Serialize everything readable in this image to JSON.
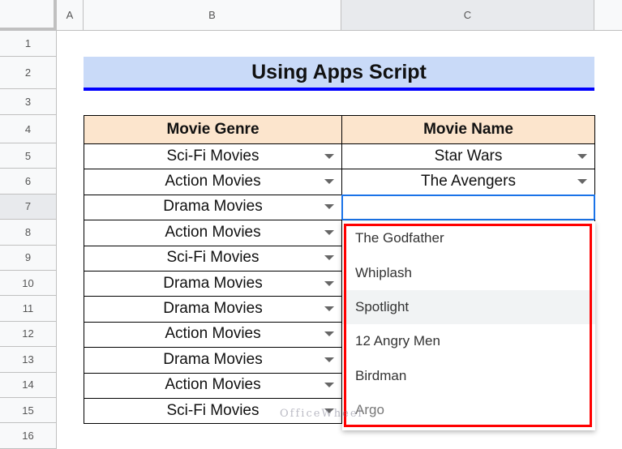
{
  "columns": [
    "A",
    "B",
    "C"
  ],
  "row_numbers": [
    "1",
    "2",
    "3",
    "4",
    "5",
    "6",
    "7",
    "8",
    "9",
    "10",
    "11",
    "12",
    "13",
    "14",
    "15",
    "16"
  ],
  "title": "Using Apps Script",
  "headers": {
    "genre": "Movie Genre",
    "name": "Movie Name"
  },
  "rows": [
    {
      "genre": "Sci-Fi Movies",
      "name": "Star Wars"
    },
    {
      "genre": "Action Movies",
      "name": "The Avengers"
    },
    {
      "genre": "Drama Movies",
      "name": ""
    },
    {
      "genre": "Action Movies",
      "name": ""
    },
    {
      "genre": "Sci-Fi Movies",
      "name": ""
    },
    {
      "genre": "Drama Movies",
      "name": ""
    },
    {
      "genre": "Drama Movies",
      "name": ""
    },
    {
      "genre": "Action Movies",
      "name": ""
    },
    {
      "genre": "Drama Movies",
      "name": ""
    },
    {
      "genre": "Action Movies",
      "name": ""
    },
    {
      "genre": "Sci-Fi Movies",
      "name": ""
    }
  ],
  "dropdown_options": [
    "The Godfather",
    "Whiplash",
    "Spotlight",
    "12 Angry Men",
    "Birdman",
    "Argo"
  ],
  "highlighted_option": "Spotlight",
  "watermark": "OfficeWheel",
  "colors": {
    "title_bg": "#c9daf8",
    "title_border": "#0000ff",
    "header_bg": "#fce5cd",
    "highlight_box": "#ff0000",
    "selection": "#1a73e8"
  }
}
